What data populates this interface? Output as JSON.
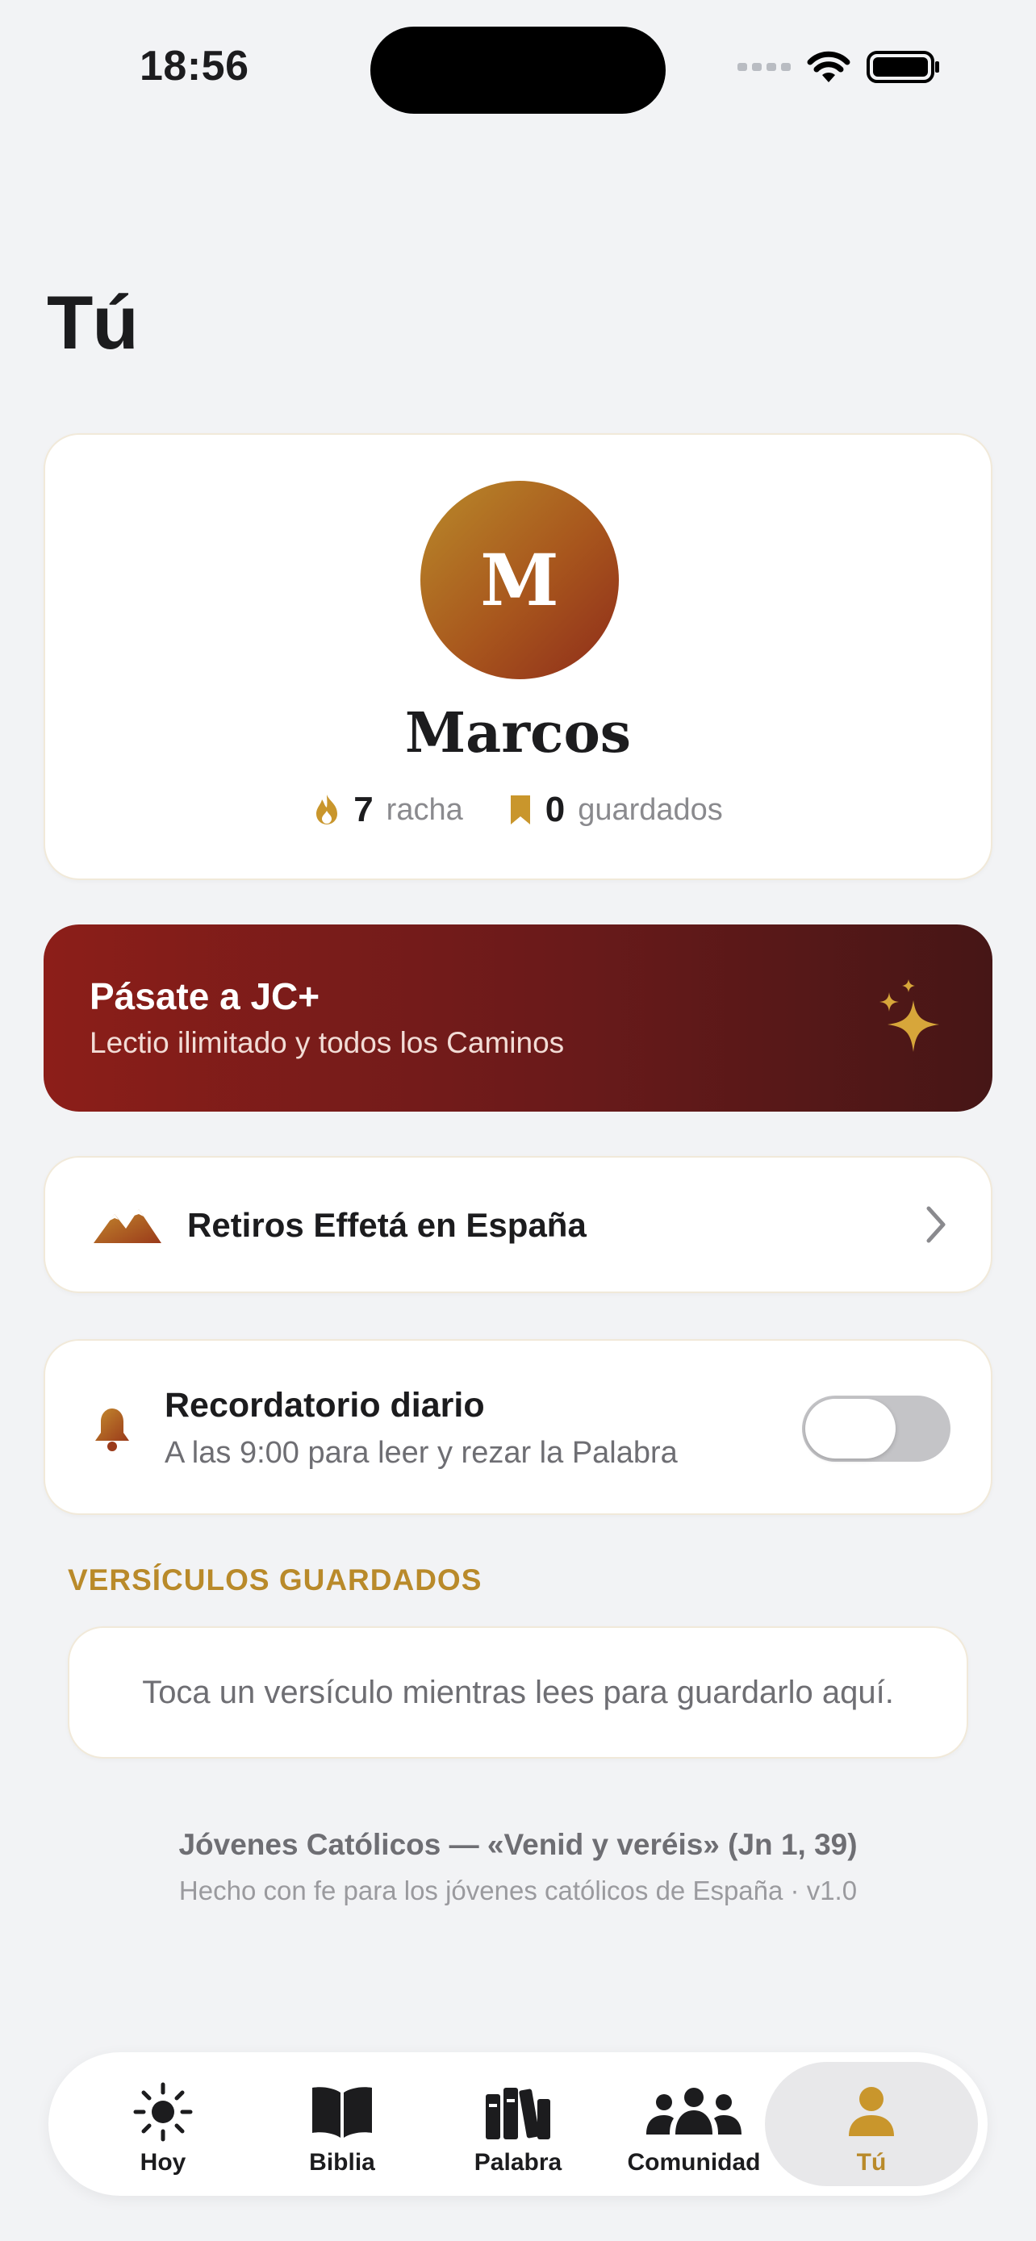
{
  "status_bar": {
    "time": "18:56"
  },
  "page": {
    "title": "Tú"
  },
  "profile": {
    "avatar_initial": "M",
    "name": "Marcos",
    "streak_value": "7",
    "streak_label": "racha",
    "saved_value": "0",
    "saved_label": "guardados"
  },
  "premium": {
    "title": "Pásate a JC+",
    "subtitle": "Lectio ilimitado y todos los Caminos"
  },
  "retiros": {
    "label": "Retiros Effetá en España"
  },
  "reminder": {
    "title": "Recordatorio diario",
    "subtitle": "A las 9:00 para leer y rezar la Palabra",
    "enabled": false
  },
  "saved_verses": {
    "header": "VERSÍCULOS GUARDADOS",
    "empty_text": "Toca un versículo mientras lees para guardarlo aquí."
  },
  "footer": {
    "line1": "Jóvenes Católicos — «Venid y veréis» (Jn 1, 39)",
    "line2": "Hecho con fe para los jóvenes católicos de España · v1.0"
  },
  "tabbar": {
    "active": "Tú",
    "items": [
      {
        "label": "Hoy",
        "icon": "sun-icon"
      },
      {
        "label": "Biblia",
        "icon": "book-icon"
      },
      {
        "label": "Palabra",
        "icon": "books-icon"
      },
      {
        "label": "Comunidad",
        "icon": "people-icon"
      },
      {
        "label": "Tú",
        "icon": "person-icon"
      }
    ]
  },
  "colors": {
    "accent_gold": "#b98a2a",
    "premium_red": "#8c1e19",
    "background": "#f2f3f5"
  }
}
